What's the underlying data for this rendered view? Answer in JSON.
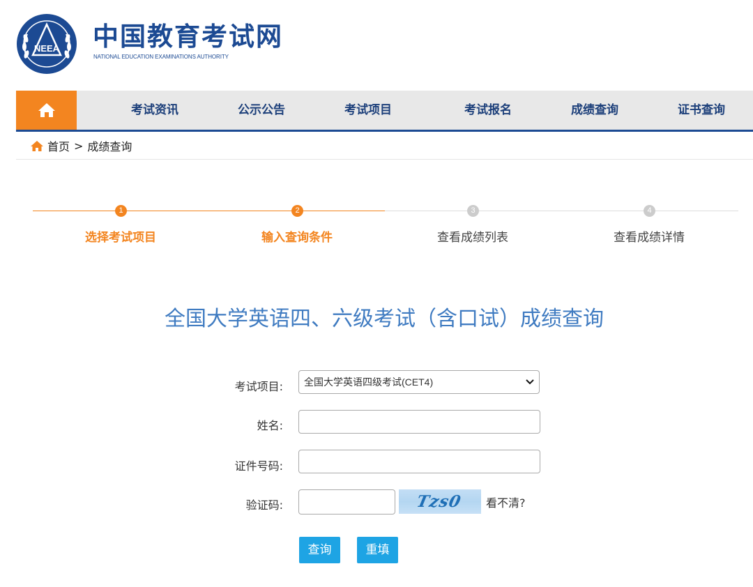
{
  "header": {
    "title": "中国教育考试网",
    "subtitle": "NATIONAL EDUCATION EXAMINATIONS AUTHORITY",
    "emblem_text": "NEEA"
  },
  "nav": {
    "items": [
      {
        "label": "考试资讯"
      },
      {
        "label": "公示公告"
      },
      {
        "label": "考试项目"
      },
      {
        "label": "考试报名"
      },
      {
        "label": "成绩查询"
      },
      {
        "label": "证书查询"
      }
    ]
  },
  "breadcrumb": {
    "home": "首页",
    "separator": ">",
    "current": "成绩查询"
  },
  "steps": [
    {
      "number": "1",
      "label": "选择考试项目",
      "active": true
    },
    {
      "number": "2",
      "label": "输入查询条件",
      "active": true
    },
    {
      "number": "3",
      "label": "查看成绩列表",
      "active": false
    },
    {
      "number": "4",
      "label": "查看成绩详情",
      "active": false
    }
  ],
  "form": {
    "heading": "全国大学英语四、六级考试（含口试）成绩查询",
    "exam_label": "考试项目:",
    "exam_selected": "全国大学英语四级考试(CET4)",
    "name_label": "姓名:",
    "name_value": "",
    "id_label": "证件号码:",
    "id_value": "",
    "captcha_label": "验证码:",
    "captcha_value": "",
    "captcha_image_text": "Tzs0",
    "captcha_refresh": "看不清?",
    "submit_label": "查询",
    "reset_label": "重填"
  },
  "colors": {
    "brand_blue": "#1c4a93",
    "accent_orange": "#f38520",
    "heading_blue": "#3f7bc1",
    "button_blue": "#1ea4e4",
    "nav_bg": "#e8e8e8"
  }
}
